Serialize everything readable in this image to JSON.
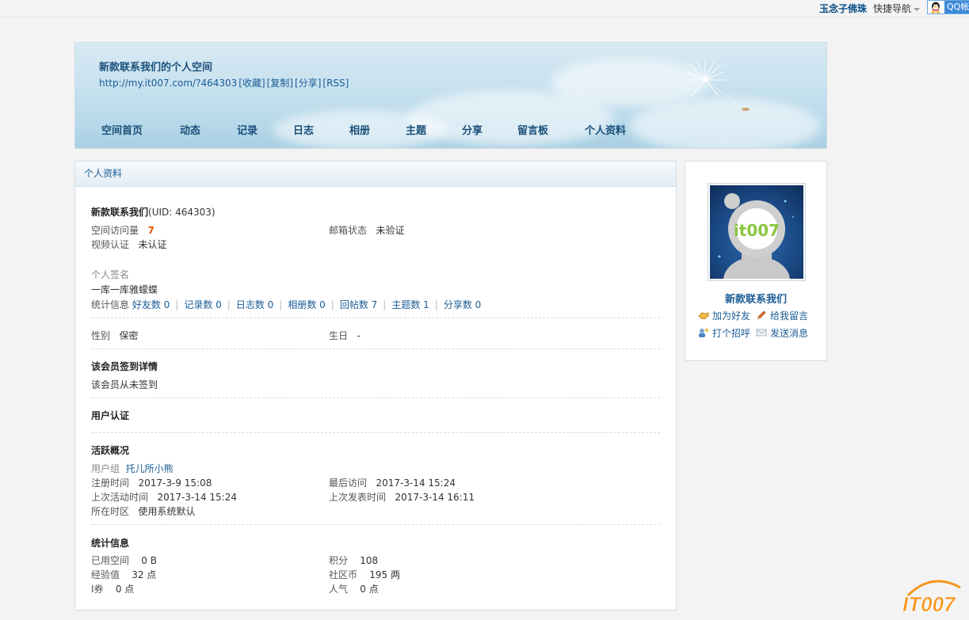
{
  "topbar": {
    "user": "玉念子佛珠",
    "quick_nav": "快捷导航",
    "qq": "QQ帐"
  },
  "banner": {
    "title": "新款联系我们的个人空间",
    "url": "http://my.it007.com/?464303",
    "links": [
      "[收藏]",
      "[复制]",
      "[分享]",
      "[RSS]"
    ],
    "nav": [
      "空间首页",
      "动态",
      "记录",
      "日志",
      "相册",
      "主题",
      "分享",
      "留言板",
      "个人资料"
    ]
  },
  "profile": {
    "panel_title": "个人资料",
    "name_uid": "新款联系我们",
    "uid": "(UID: 464303)",
    "visits_label": "空间访问量",
    "visits_value": "7",
    "email_label": "邮箱状态",
    "email_value": "未验证",
    "video_label": "视频认证",
    "video_value": "未认证",
    "signature_label": "个人签名",
    "signature_value": "一库一库雅蠓蝶",
    "stats_label": "统计信息",
    "stats": [
      "好友数 0",
      "记录数 0",
      "日志数 0",
      "相册数 0",
      "回帖数 7",
      "主题数 1",
      "分享数 0"
    ],
    "gender_label": "性别",
    "gender_value": "保密",
    "birthday_label": "生日",
    "birthday_value": "-",
    "checkin_heading": "该会员签到详情",
    "checkin_value": "该会员从未签到",
    "auth_heading": "用户认证",
    "activity_heading": "活跃概况",
    "group_label": "用户组",
    "group_value": "托儿所小熊",
    "reg_label": "注册时间",
    "reg_value": "2017-3-9 15:08",
    "last_visit_label": "最后访问",
    "last_visit_value": "2017-3-14 15:24",
    "last_active_label": "上次活动时间",
    "last_active_value": "2017-3-14 15:24",
    "last_post_label": "上次发表时间",
    "last_post_value": "2017-3-14 16:11",
    "tz_label": "所在时区",
    "tz_value": "使用系统默认",
    "stats_heading": "统计信息",
    "space_label": "已用空间",
    "space_value": "0 B",
    "points_label": "积分",
    "points_value": "108",
    "exp_label": "经验值",
    "exp_value": "32 点",
    "coin_label": "社区币",
    "coin_value": "195 两",
    "coupon_label": "I券",
    "coupon_value": "0 点",
    "pop_label": "人气",
    "pop_value": "0 点"
  },
  "sidebar": {
    "name": "新款联系我们",
    "add_friend": "加为好友",
    "leave_msg": "给我留言",
    "greet": "打个招呼",
    "send_msg": "发送消息",
    "avatar_text": "it007"
  },
  "footer_logo": "IT007",
  "colors": {
    "link": "#1a5c96",
    "accent": "#e55a00",
    "logo_orange": "#f7941d",
    "logo_blue": "#1e73be"
  }
}
